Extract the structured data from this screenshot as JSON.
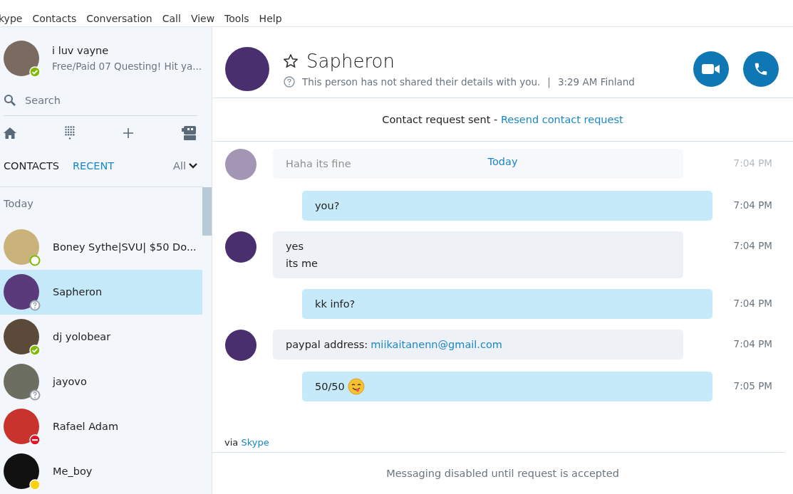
{
  "menu_bar": [
    "kype",
    "Contacts",
    "Conversation",
    "Call",
    "View",
    "Tools",
    "Help"
  ],
  "profile": {
    "name": "i luv vayne",
    "mood": "Free/Paid 07 Questing! Hit ya...",
    "kind": "online"
  },
  "search": {
    "placeholder": "Search"
  },
  "tabs": [
    {
      "label": "CONTACTS",
      "selected": false
    },
    {
      "label": "RECENT",
      "selected": true
    }
  ],
  "filter": {
    "label": "All"
  },
  "recent": {
    "group": "Today",
    "contacts": [
      {
        "name": "Boney Sythe|SVU| $50 Do...",
        "kind": "mobile",
        "selected": false
      },
      {
        "name": "Sapheron",
        "kind": "unknown",
        "selected": true
      },
      {
        "name": "dj yolobear",
        "kind": "online",
        "selected": false
      },
      {
        "name": "jayovo",
        "kind": "unknown",
        "selected": false
      },
      {
        "name": "Rafael Adam",
        "kind": "busy",
        "selected": false
      },
      {
        "name": "Me_boy",
        "kind": "away",
        "selected": false
      }
    ]
  },
  "conversation": {
    "name": "Sapheron",
    "details": "This person has not shared their details with you.",
    "separator": "|",
    "local_time": "3:29 AM Finland",
    "request_text": "Contact request sent - ",
    "request_link": "Resend contact request",
    "date_divider": "Today",
    "messages": [
      {
        "kind": "received",
        "faded": true,
        "lines": [
          "Haha its fine"
        ],
        "time": "7:04 PM"
      },
      {
        "kind": "sent",
        "faded": false,
        "lines": [
          "you?"
        ],
        "time": "7:04 PM"
      },
      {
        "kind": "received",
        "faded": false,
        "lines": [
          "yes",
          "its me"
        ],
        "time": "7:04 PM"
      },
      {
        "kind": "sent",
        "faded": false,
        "lines": [
          "kk info?"
        ],
        "time": "7:04 PM"
      },
      {
        "kind": "received",
        "faded": false,
        "lines": [
          "paypal address: "
        ],
        "link": "miikaitanenn@gmail.com",
        "time": "7:04 PM"
      },
      {
        "kind": "sent",
        "faded": false,
        "lines": [
          "50/50"
        ],
        "emoji": true,
        "time": "7:05 PM"
      }
    ],
    "via_text": "via ",
    "via_link": "Skype",
    "footer": "Messaging disabled until request is accepted"
  }
}
